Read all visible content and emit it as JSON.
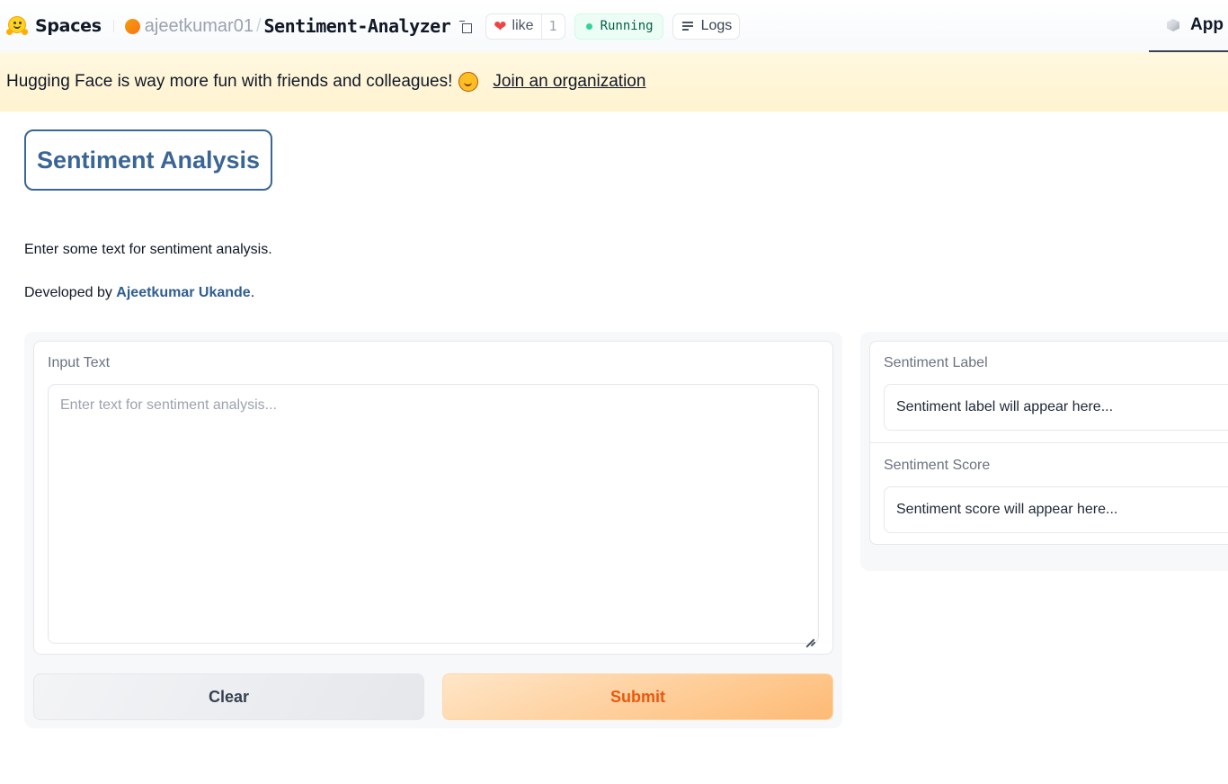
{
  "header": {
    "brand_label": "Spaces",
    "owner": "ajeetkumar01",
    "separator": "/",
    "repo_name": "Sentiment-Analyzer",
    "like_label": "like",
    "like_count": "1",
    "status_label": "Running",
    "logs_label": "Logs",
    "app_tab_label": "App",
    "icons": {
      "brand": "hugging-face-logo-icon",
      "owner": "avatar-circle",
      "copy": "copy-icon",
      "like": "heart-icon",
      "status": "green-dot-icon",
      "logs": "list-icon",
      "app": "cube-icon"
    }
  },
  "banner": {
    "text": "Hugging Face is way more fun with friends and colleagues!",
    "emoji": "hugging-face-emoji",
    "link_label": "Join an organization"
  },
  "intro": {
    "title": "Sentiment Analysis",
    "description": "Enter some text for sentiment analysis.",
    "developed_by_prefix": "Developed by ",
    "developer_name": "Ajeetkumar Ukande",
    "developed_by_suffix": "."
  },
  "input": {
    "label": "Input Text",
    "value": "",
    "placeholder": "Enter text for sentiment analysis..."
  },
  "buttons": {
    "clear_label": "Clear",
    "submit_label": "Submit"
  },
  "outputs": [
    {
      "label": "Sentiment Label",
      "value": "Sentiment label will appear here..."
    },
    {
      "label": "Sentiment Score",
      "value": "Sentiment score will appear here..."
    }
  ],
  "colors": {
    "title_accent": "#3a6595",
    "submit_text": "#ea580c",
    "status_green": "#34d399",
    "like_red": "#ef4444",
    "banner_bg": "#fff6dc"
  }
}
